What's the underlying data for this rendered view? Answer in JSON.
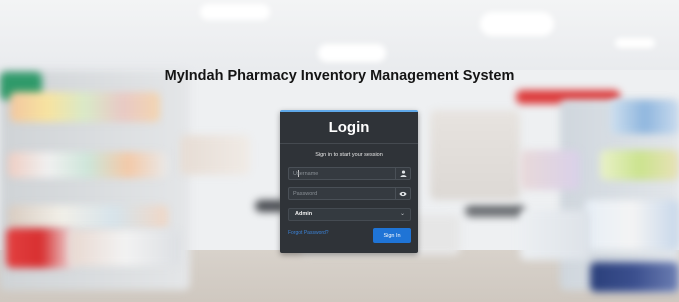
{
  "page": {
    "title": "MyIndah Pharmacy Inventory Management System"
  },
  "login": {
    "heading": "Login",
    "subtitle": "Sign in to start your session",
    "username_placeholder": "Username",
    "password_placeholder": "Password",
    "role_selected": "Admin",
    "forgot_link": "Forgot Password?",
    "signin_label": "Sign In"
  },
  "icons": {
    "username": "user-icon",
    "password": "eye-icon",
    "role": "chevron-down-icon"
  },
  "colors": {
    "card_bg": "#2f3338",
    "card_accent": "#5fa8e8",
    "primary_button": "#1f74d6",
    "link": "#3b82d6"
  }
}
